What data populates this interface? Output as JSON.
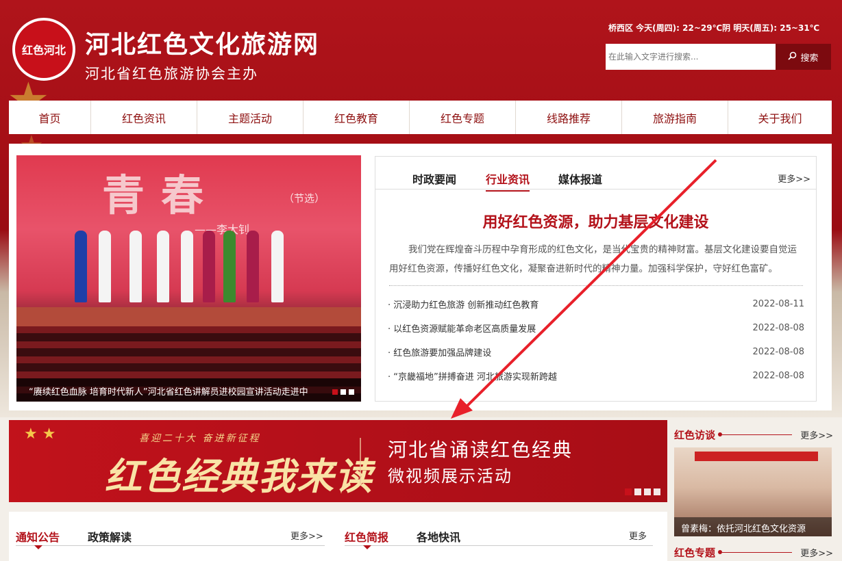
{
  "header": {
    "logo_text": "红色河北",
    "title": "河北红色文化旅游网",
    "subtitle": "河北省红色旅游协会主办",
    "weather": "桥西区   今天(周四): 22~29℃阴  明天(周五): 25~31℃",
    "search_placeholder": "在此输入文字进行搜索...",
    "search_button": "搜索"
  },
  "nav": {
    "items": [
      "首页",
      "红色资讯",
      "主题活动",
      "红色教育",
      "红色专题",
      "线路推荐",
      "旅游指南",
      "关于我们"
    ]
  },
  "slide": {
    "big_text": "青春",
    "small_text": "（节选）",
    "author_text": "——李大钊",
    "caption": "“赓续红色血脉 培育时代新人”河北省红色讲解员进校园宣讲活动走进中"
  },
  "news": {
    "tabs": [
      "时政要闻",
      "行业资讯",
      "媒体报道"
    ],
    "active_tab": "行业资讯",
    "more": "更多>>",
    "headline": "用好红色资源，助力基层文化建设",
    "summary": "我们党在辉煌奋斗历程中孕育形成的红色文化，是当代宝贵的精神财富。基层文化建设要自觉运用好红色资源，传播好红色文化，凝聚奋进新时代的精神力量。加强科学保护，守好红色富矿。",
    "items": [
      {
        "title": "沉浸助力红色旅游 创新推动红色教育",
        "date": "2022-08-11"
      },
      {
        "title": "以红色资源赋能革命老区高质量发展",
        "date": "2022-08-08"
      },
      {
        "title": "红色旅游要加强品牌建设",
        "date": "2022-08-08"
      },
      {
        "title": "“京畿福地”拼搏奋进 河北旅游实现新跨越",
        "date": "2022-08-08"
      }
    ]
  },
  "banner": {
    "top_text": "喜迎二十大  奋进新征程",
    "big_text": "红色经典我来读",
    "right_line1": "河北省诵读红色经典",
    "right_line2": "微视频展示活动"
  },
  "sidebar": {
    "section1_title": "红色访谈",
    "section1_more": "更多>>",
    "image_caption": "曾素梅：依托河北红色文化资源",
    "section2_title": "红色专题",
    "section2_more": "更多>>"
  },
  "bottom": {
    "left_tabs": [
      "通知公告",
      "政策解读"
    ],
    "left_more": "更多>>",
    "right_tabs": [
      "红色简报",
      "各地快讯"
    ],
    "right_more": "更多"
  },
  "colors": {
    "brand_red": "#b3121a",
    "header_red": "#a50f16",
    "search_button": "#7c0a0f"
  }
}
